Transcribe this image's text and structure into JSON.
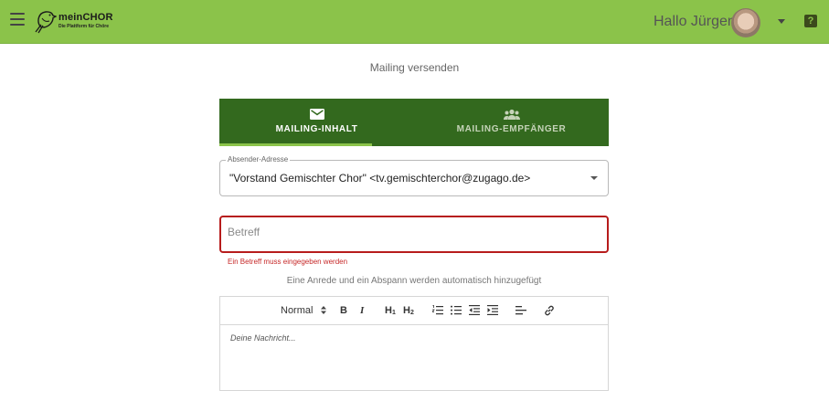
{
  "header": {
    "logo_name": "meinCHOR",
    "logo_tagline": "Die Plattform für Chöre",
    "greeting": "Hallo Jürgen",
    "help_label": "?"
  },
  "page": {
    "title": "Mailing versenden"
  },
  "tabs": [
    {
      "label": "MAILING-INHALT",
      "icon": "mail-icon",
      "active": true
    },
    {
      "label": "MAILING-EMPFÄNGER",
      "icon": "group-icon",
      "active": false
    }
  ],
  "sender": {
    "legend": "Absender-Adresse",
    "value": "\"Vorstand Gemischter Chor\" <tv.gemischterchor@zugago.de>"
  },
  "subject": {
    "placeholder": "Betreff",
    "value": "",
    "error": "Ein Betreff muss eingegeben werden"
  },
  "hint": "Eine Anrede und ein Abspann werden automatisch hinzugefügt",
  "toolbar": {
    "format_select": "Normal",
    "bold": "B",
    "italic": "I",
    "h1": "H",
    "h1_sub": "1",
    "h2": "H",
    "h2_sub": "2"
  },
  "editor": {
    "placeholder": "Deine Nachricht..."
  },
  "colors": {
    "header_bg": "#8bc34a",
    "tab_bg": "#33691e",
    "error": "#c62828"
  }
}
